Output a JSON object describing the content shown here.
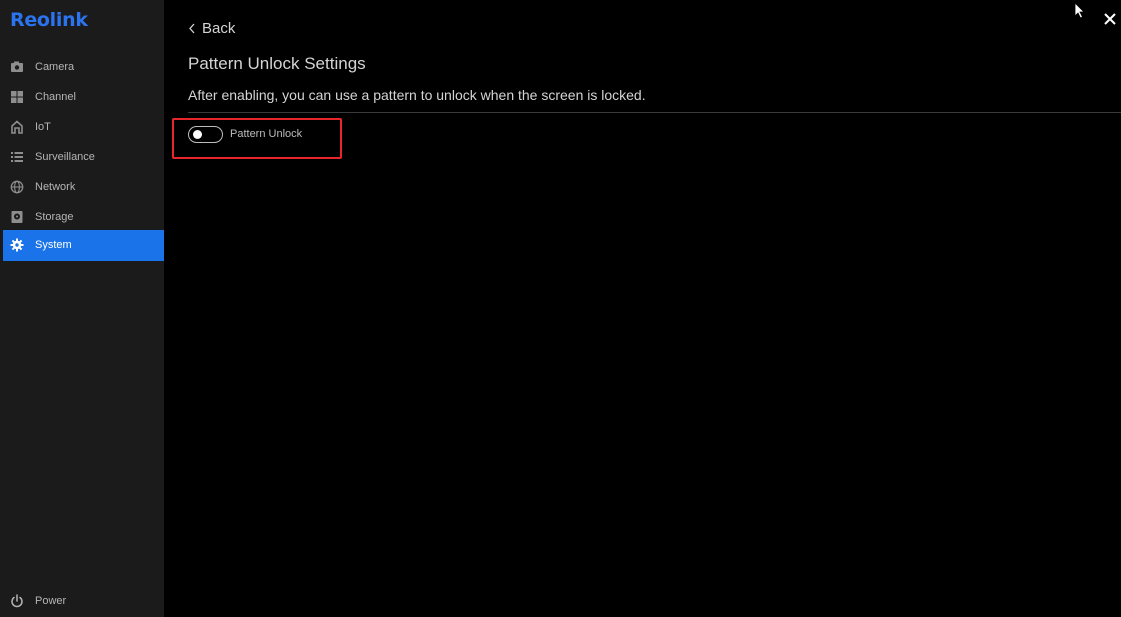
{
  "brand": {
    "logo_text": "Reolink",
    "logo_color": "#2b74f0"
  },
  "sidebar": {
    "active_color": "#1a73e8",
    "items": [
      {
        "label": "Camera",
        "icon": "camera-icon"
      },
      {
        "label": "Channel",
        "icon": "grid-icon"
      },
      {
        "label": "IoT",
        "icon": "home-icon"
      },
      {
        "label": "Surveillance",
        "icon": "list-icon"
      },
      {
        "label": "Network",
        "icon": "globe-icon"
      },
      {
        "label": "Storage",
        "icon": "storage-icon"
      },
      {
        "label": "System",
        "icon": "gear-icon",
        "active": true
      }
    ],
    "power": {
      "label": "Power",
      "icon": "power-icon"
    }
  },
  "main": {
    "back_label": "Back",
    "title": "Pattern Unlock Settings",
    "description": "After enabling, you can use a pattern to unlock when the screen is locked.",
    "toggle": {
      "label": "Pattern Unlock",
      "enabled": false
    },
    "highlight_color": "#e8252a"
  },
  "window": {
    "close_icon": "close-icon"
  }
}
